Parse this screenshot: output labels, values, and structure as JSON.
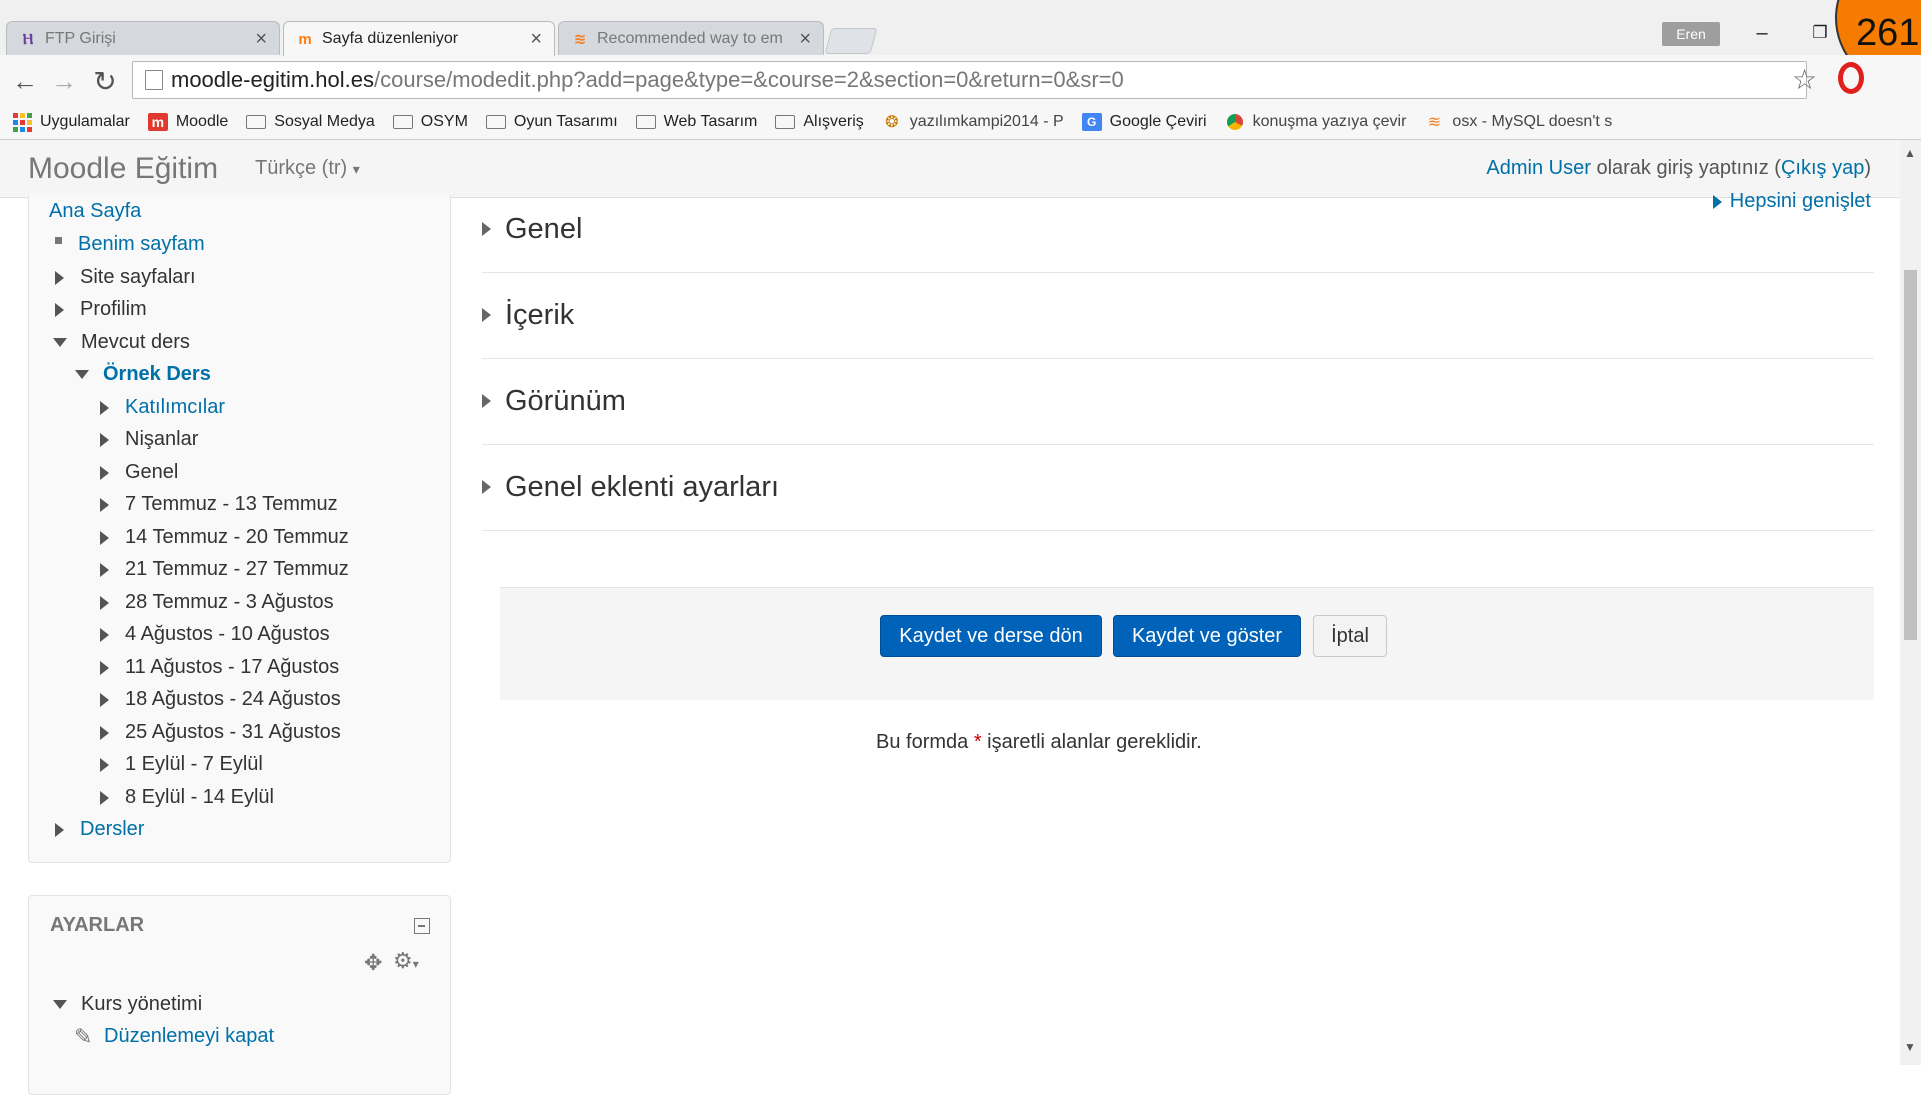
{
  "browser": {
    "tabs": [
      {
        "title": "FTP Girişi",
        "favicon": "host-icon"
      },
      {
        "title": "Sayfa düzenleniyor",
        "favicon": "moodle-icon"
      },
      {
        "title": "Recommended way to em",
        "favicon": "stackoverflow-icon"
      }
    ],
    "user_badge": "Eren",
    "counter": "261",
    "url_host": "moodle-egitim.hol.es",
    "url_path": "/course/modedit.php?add=page&type=&course=2&section=0&return=0&sr=0",
    "bookmarks": [
      {
        "label": "Uygulamalar",
        "icon": "apps-icon"
      },
      {
        "label": "Moodle",
        "icon": "moodle-icon"
      },
      {
        "label": "Sosyal Medya",
        "icon": "folder-icon"
      },
      {
        "label": "OSYM",
        "icon": "folder-icon"
      },
      {
        "label": "Oyun Tasarımı",
        "icon": "folder-icon"
      },
      {
        "label": "Web Tasarım",
        "icon": "folder-icon"
      },
      {
        "label": "Alışveriş",
        "icon": "folder-icon"
      },
      {
        "label": "yazılımkampi2014 - P",
        "icon": "tiger-icon"
      },
      {
        "label": "Google Çeviri",
        "icon": "translate-icon"
      },
      {
        "label": "konuşma yazıya çevir",
        "icon": "chrome-icon"
      },
      {
        "label": "osx - MySQL doesn't s",
        "icon": "stackoverflow-icon"
      }
    ]
  },
  "navbar": {
    "brand": "Moodle Eğitim",
    "language": "Türkçe (tr)",
    "user_name": "Admin User",
    "login_text": " olarak giriş yaptınız (",
    "logout": "Çıkış yap",
    "logout_close": ")"
  },
  "navigation": {
    "home": "Ana Sayfa",
    "my_page": "Benim sayfam",
    "site_pages": "Site sayfaları",
    "profile": "Profilim",
    "current_course": "Mevcut ders",
    "course_name": "Örnek Ders",
    "participants": "Katılımcılar",
    "badges": "Nişanlar",
    "general": "Genel",
    "weeks": [
      "7 Temmuz - 13 Temmuz",
      "14 Temmuz - 20 Temmuz",
      "21 Temmuz - 27 Temmuz",
      "28 Temmuz - 3 Ağustos",
      "4 Ağustos - 10 Ağustos",
      "11 Ağustos - 17 Ağustos",
      "18 Ağustos - 24 Ağustos",
      "25 Ağustos - 31 Ağustos",
      "1 Eylül - 7 Eylül",
      "8 Eylül - 14 Eylül"
    ],
    "courses": "Dersler"
  },
  "settings": {
    "title": "AYARLAR",
    "course_admin": "Kurs yönetimi",
    "turn_editing_off": "Düzenlemeyi kapat"
  },
  "form": {
    "expand_all": "Hepsini genişlet",
    "sections": [
      "Genel",
      "İçerik",
      "Görünüm",
      "Genel eklenti ayarları"
    ],
    "save_return": "Kaydet ve derse dön",
    "save_display": "Kaydet ve göster",
    "cancel": "İptal",
    "required_before": "Bu formda ",
    "required_star": "*",
    "required_after": " işaretli alanlar gereklidir."
  }
}
